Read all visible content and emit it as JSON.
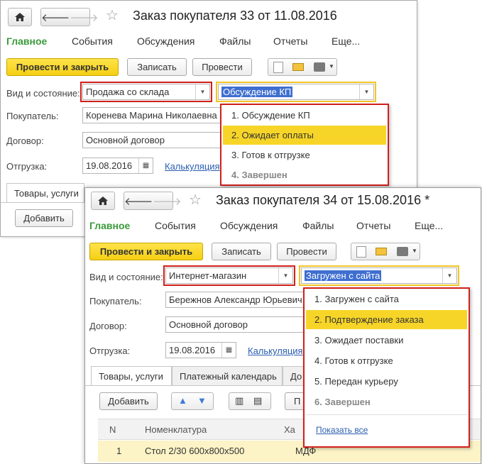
{
  "w1": {
    "title": "Заказ покупателя 33 от 11.08.2016",
    "menu": [
      "Главное",
      "События",
      "Обсуждения",
      "Файлы",
      "Отчеты",
      "Еще..."
    ],
    "btn_post_close": "Провести и закрыть",
    "btn_save": "Записать",
    "btn_post": "Провести",
    "lbl_state": "Вид и состояние:",
    "kind": "Продажа со склада",
    "status": "Обсуждение КП",
    "lbl_buyer": "Покупатель:",
    "buyer": "Коренева Марина Николаевна",
    "lbl_contract": "Договор:",
    "contract": "Основной договор",
    "lbl_ship": "Отгрузка:",
    "ship_date": "19.08.2016",
    "calc_link": "Калькуляция",
    "tab_goods": "Товары, услуги",
    "btn_add": "Добавить",
    "popup": [
      "1. Обсуждение КП",
      "2. Ожидает оплаты",
      "3. Готов к отгрузке",
      "4. Завершен"
    ]
  },
  "w2": {
    "title": "Заказ покупателя 34 от 15.08.2016 *",
    "menu": [
      "Главное",
      "События",
      "Обсуждения",
      "Файлы",
      "Отчеты",
      "Еще..."
    ],
    "btn_post_close": "Провести и закрыть",
    "btn_save": "Записать",
    "btn_post": "Провести",
    "lbl_state": "Вид и состояние:",
    "kind": "Интернет-магазин",
    "status": "Загружен с сайта",
    "lbl_buyer": "Покупатель:",
    "buyer": "Бережнов Александр Юрьевич",
    "lbl_contract": "Договор:",
    "contract": "Основной договор",
    "lbl_ship": "Отгрузка:",
    "ship_date": "19.08.2016",
    "calc_link": "Калькуляция",
    "tabs": [
      "Товары, услуги",
      "Платежный календарь",
      "До"
    ],
    "btn_add": "Добавить",
    "btn_partial": "П",
    "col_n": "N",
    "col_item": "Номенклатура",
    "col_char": "Ха",
    "row": {
      "n": "1",
      "item": "Стол 2/30 600х800х500",
      "char": "МДФ"
    },
    "popup": [
      "1. Загружен с сайта",
      "2. Подтверждение заказа",
      "3. Ожидает поставки",
      "4. Готов к отгрузке",
      "5. Передан курьеру",
      "6. Завершен"
    ],
    "show_all": "Показать все"
  }
}
